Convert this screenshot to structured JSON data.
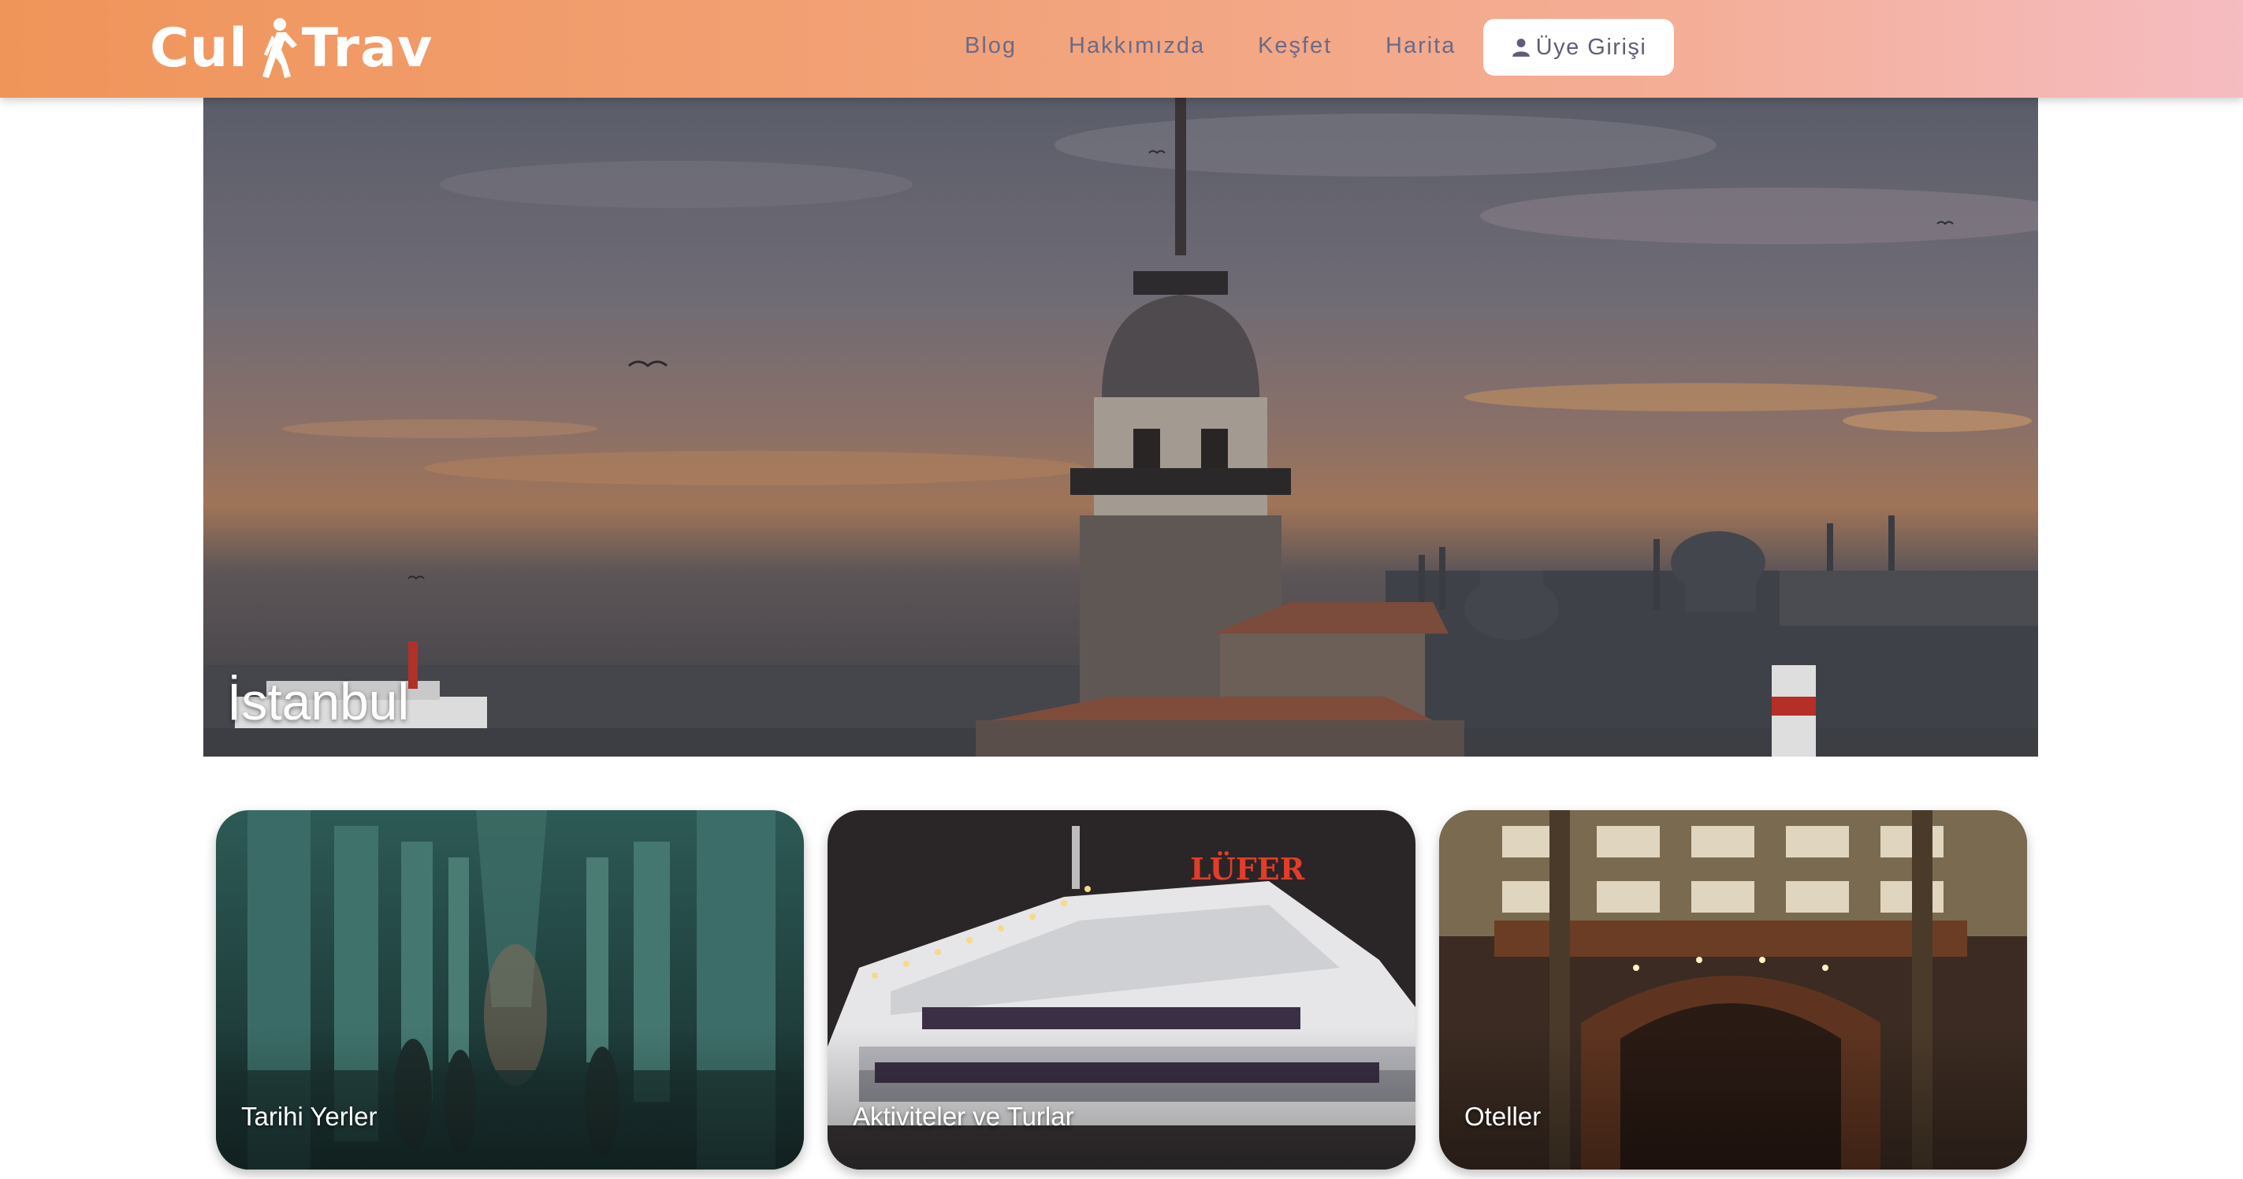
{
  "brand": {
    "logo_part1": "Cul",
    "logo_part2": "Trav",
    "logo_icon": "walking-traveler-icon"
  },
  "nav": {
    "items": [
      {
        "label": "Blog"
      },
      {
        "label": "Hakkımızda"
      },
      {
        "label": "Keşfet"
      },
      {
        "label": "Harita"
      }
    ],
    "login": {
      "label": "Üye Girişi",
      "icon": "user-icon"
    }
  },
  "hero": {
    "title": "İstanbul"
  },
  "cards": [
    {
      "label": "Tarihi Yerler"
    },
    {
      "label": "Aktiviteler ve Turlar"
    },
    {
      "label": "Oteller"
    }
  ],
  "boat_sign": "LÜFER",
  "colors": {
    "nav_start": "#f0955a",
    "nav_end": "#f5bcc1",
    "nav_text": "#6b6a88"
  }
}
